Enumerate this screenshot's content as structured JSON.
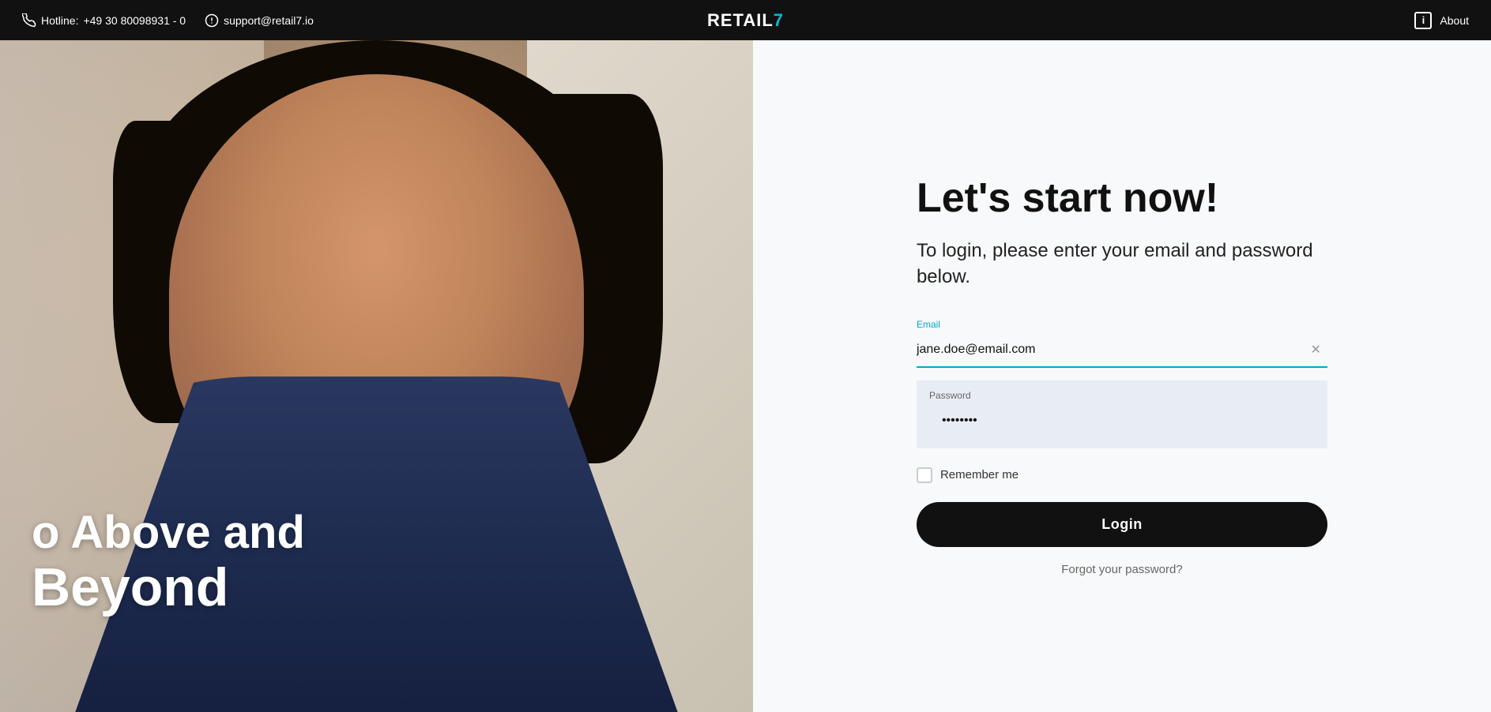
{
  "navbar": {
    "hotline_label": "Hotline:",
    "hotline_number": "+49 30 80098931 - 0",
    "support_email": "support@retail7.io",
    "logo": "RETAIL",
    "logo_accent": "7",
    "about_label": "About"
  },
  "login": {
    "title": "Let's start now!",
    "subtitle": "To login, please enter your email and password below.",
    "email_label": "Email",
    "email_value": "jane.doe@email.com",
    "email_placeholder": "jane.doe@email.com",
    "password_label": "Password",
    "password_value": "••••••••",
    "remember_label": "Remember me",
    "login_button": "Login",
    "forgot_label": "Forgot your password?"
  },
  "hero": {
    "line1": "o Above and",
    "line2": "Beyond"
  }
}
